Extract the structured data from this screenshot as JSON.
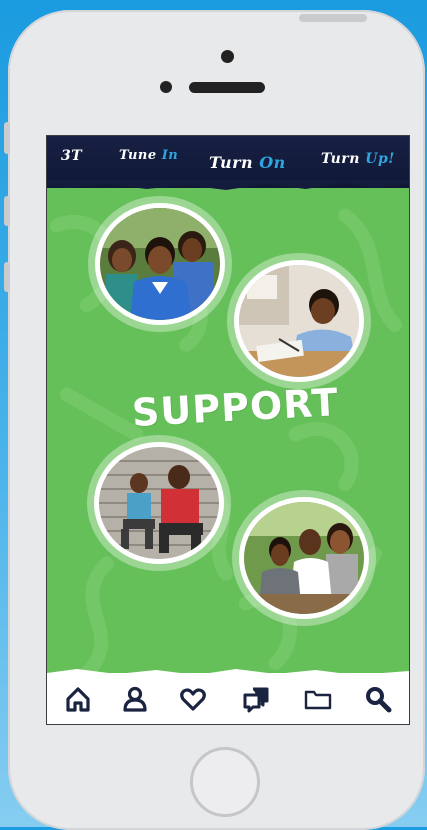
{
  "header": {
    "logo": "3T",
    "tune": "Tune",
    "tune_accent": "In",
    "turn_on": "Turn",
    "turn_on_accent": "On",
    "turn_up": "Turn",
    "turn_up_accent": "Up!"
  },
  "main": {
    "title": "SUPPORT"
  },
  "tabbar": {
    "icons": [
      "home-icon",
      "user-icon",
      "heart-icon",
      "chat-icon",
      "folder-icon",
      "search-icon"
    ]
  },
  "colors": {
    "background_green": "#66c05a",
    "header_navy": "#131c3d",
    "accent_blue": "#2fa5df",
    "icon_navy": "#1a2340"
  }
}
